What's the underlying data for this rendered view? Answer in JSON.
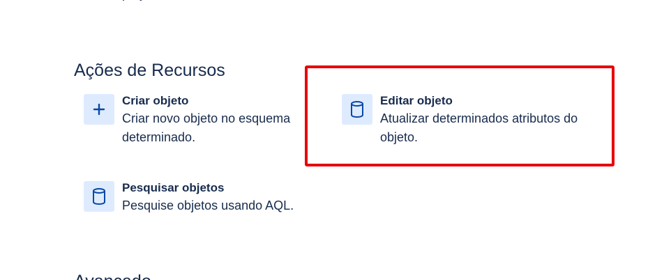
{
  "previous_item": {
    "description_tail": "projeto"
  },
  "sections": {
    "resource_actions": {
      "title": "Ações de Recursos",
      "items": [
        {
          "icon": "plus-icon",
          "title": "Criar objeto",
          "description": "Criar novo objeto no esquema determinado."
        },
        {
          "icon": "database-icon",
          "title": "Editar objeto",
          "description": "Atualizar determinados atributos do objeto."
        },
        {
          "icon": "database-icon",
          "title": "Pesquisar objetos",
          "description": "Pesquise objetos usando AQL."
        }
      ]
    },
    "advanced": {
      "title": "Avançado"
    }
  },
  "colors": {
    "text": "#172b4d",
    "icon_background": "#deebff",
    "icon": "#0747a6",
    "highlight": "#e8000b"
  }
}
